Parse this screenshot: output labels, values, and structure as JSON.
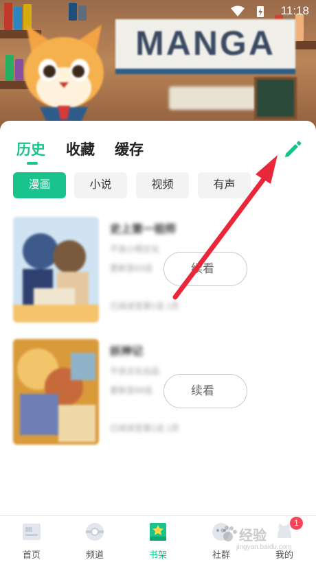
{
  "status_bar": {
    "time": "11:18"
  },
  "banner": {
    "title": "MANGA"
  },
  "tabs": [
    {
      "label": "历史",
      "active": true
    },
    {
      "label": "收藏",
      "active": false
    },
    {
      "label": "缓存",
      "active": false
    }
  ],
  "edit_icon": "pencil-icon",
  "chips": [
    {
      "label": "漫画",
      "active": true
    },
    {
      "label": "小说",
      "active": false
    },
    {
      "label": "视频",
      "active": false
    },
    {
      "label": "有声",
      "active": false
    }
  ],
  "history": [
    {
      "title": "史上第一祖师",
      "line1": "不良小明文化",
      "line2": "更新至63话",
      "line3": "已阅读至第1话 1页",
      "continue_label": "续看"
    },
    {
      "title": "妖神记",
      "line1": "不良文化出品",
      "line2": "更新至99话",
      "line3": "已阅读至第1话 1页",
      "continue_label": "续看"
    }
  ],
  "bottom_nav": [
    {
      "label": "首页",
      "icon": "home-icon",
      "active": false
    },
    {
      "label": "频道",
      "icon": "channel-icon",
      "active": false
    },
    {
      "label": "书架",
      "icon": "bookshelf-icon",
      "active": true
    },
    {
      "label": "社群",
      "icon": "community-icon",
      "active": false
    },
    {
      "label": "我的",
      "icon": "profile-icon",
      "active": false,
      "badge": "1"
    }
  ],
  "watermark": {
    "text": "经验",
    "url": "jingyan.baidu.com"
  },
  "colors": {
    "accent": "#18c38c",
    "arrow": "#e8283a",
    "badge": "#f5455b"
  }
}
